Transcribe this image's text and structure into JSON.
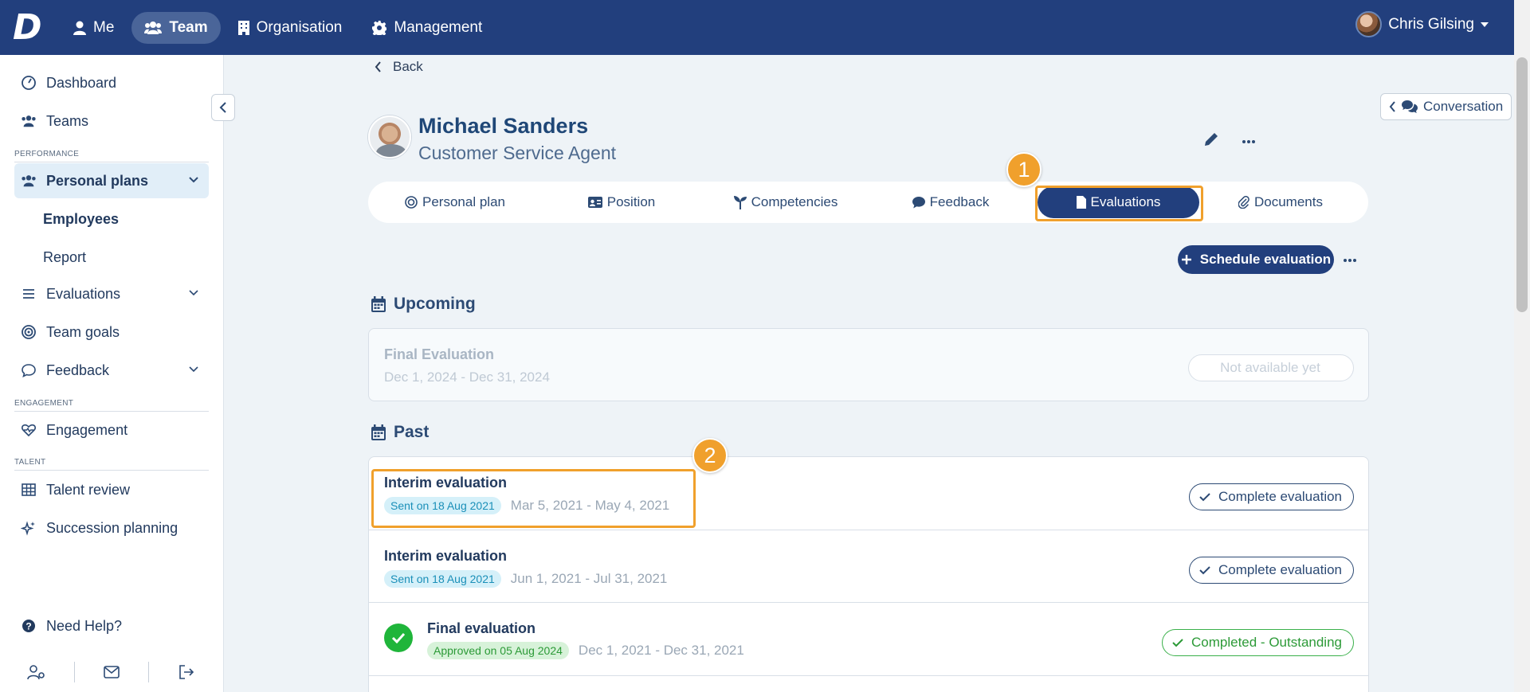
{
  "topbar": {
    "logo": "D",
    "nav": [
      {
        "label": "Me",
        "icon": "person-icon"
      },
      {
        "label": "Team",
        "icon": "users-icon"
      },
      {
        "label": "Organisation",
        "icon": "building-icon"
      },
      {
        "label": "Management",
        "icon": "gear-icon"
      }
    ],
    "user_name": "Chris Gilsing"
  },
  "sidebar": {
    "dashboard": "Dashboard",
    "teams": "Teams",
    "section_performance": "PERFORMANCE",
    "personal_plans": "Personal plans",
    "employees": "Employees",
    "report": "Report",
    "evaluations": "Evaluations",
    "team_goals": "Team goals",
    "feedback": "Feedback",
    "section_engagement": "ENGAGEMENT",
    "engagement": "Engagement",
    "section_talent": "TALENT",
    "talent_review": "Talent review",
    "succession_planning": "Succession planning",
    "need_help": "Need Help?"
  },
  "main": {
    "back": "Back",
    "conversation": "Conversation",
    "profile": {
      "name": "Michael Sanders",
      "role": "Customer Service Agent"
    },
    "tabs": [
      "Personal plan",
      "Position",
      "Competencies",
      "Feedback",
      "Evaluations",
      "Documents"
    ],
    "active_tab": "Evaluations",
    "schedule_btn": "Schedule evaluation",
    "upcoming_title": "Upcoming",
    "upcoming": {
      "title": "Final Evaluation",
      "dates": "Dec 1, 2024 - Dec 31, 2024",
      "button": "Not available yet"
    },
    "past_title": "Past",
    "past": [
      {
        "title": "Interim evaluation",
        "pill": "Sent on 18 Aug 2021",
        "dates": "Mar 5, 2021 - May 4, 2021",
        "button": "Complete evaluation"
      },
      {
        "title": "Interim evaluation",
        "pill": "Sent on 18 Aug 2021",
        "dates": "Jun 1, 2021 - Jul 31, 2021",
        "button": "Complete evaluation"
      },
      {
        "title": "Final evaluation",
        "pill": "Approved on 05 Aug 2024",
        "dates": "Dec 1, 2021 - Dec 31, 2021",
        "button": "Completed - Outstanding"
      }
    ],
    "step_badges": [
      "1",
      "2"
    ]
  },
  "colors": {
    "nav_bg": "#223f7d",
    "accent": "#223f7d",
    "highlight": "#f0a02c",
    "success": "#1fb53a"
  }
}
